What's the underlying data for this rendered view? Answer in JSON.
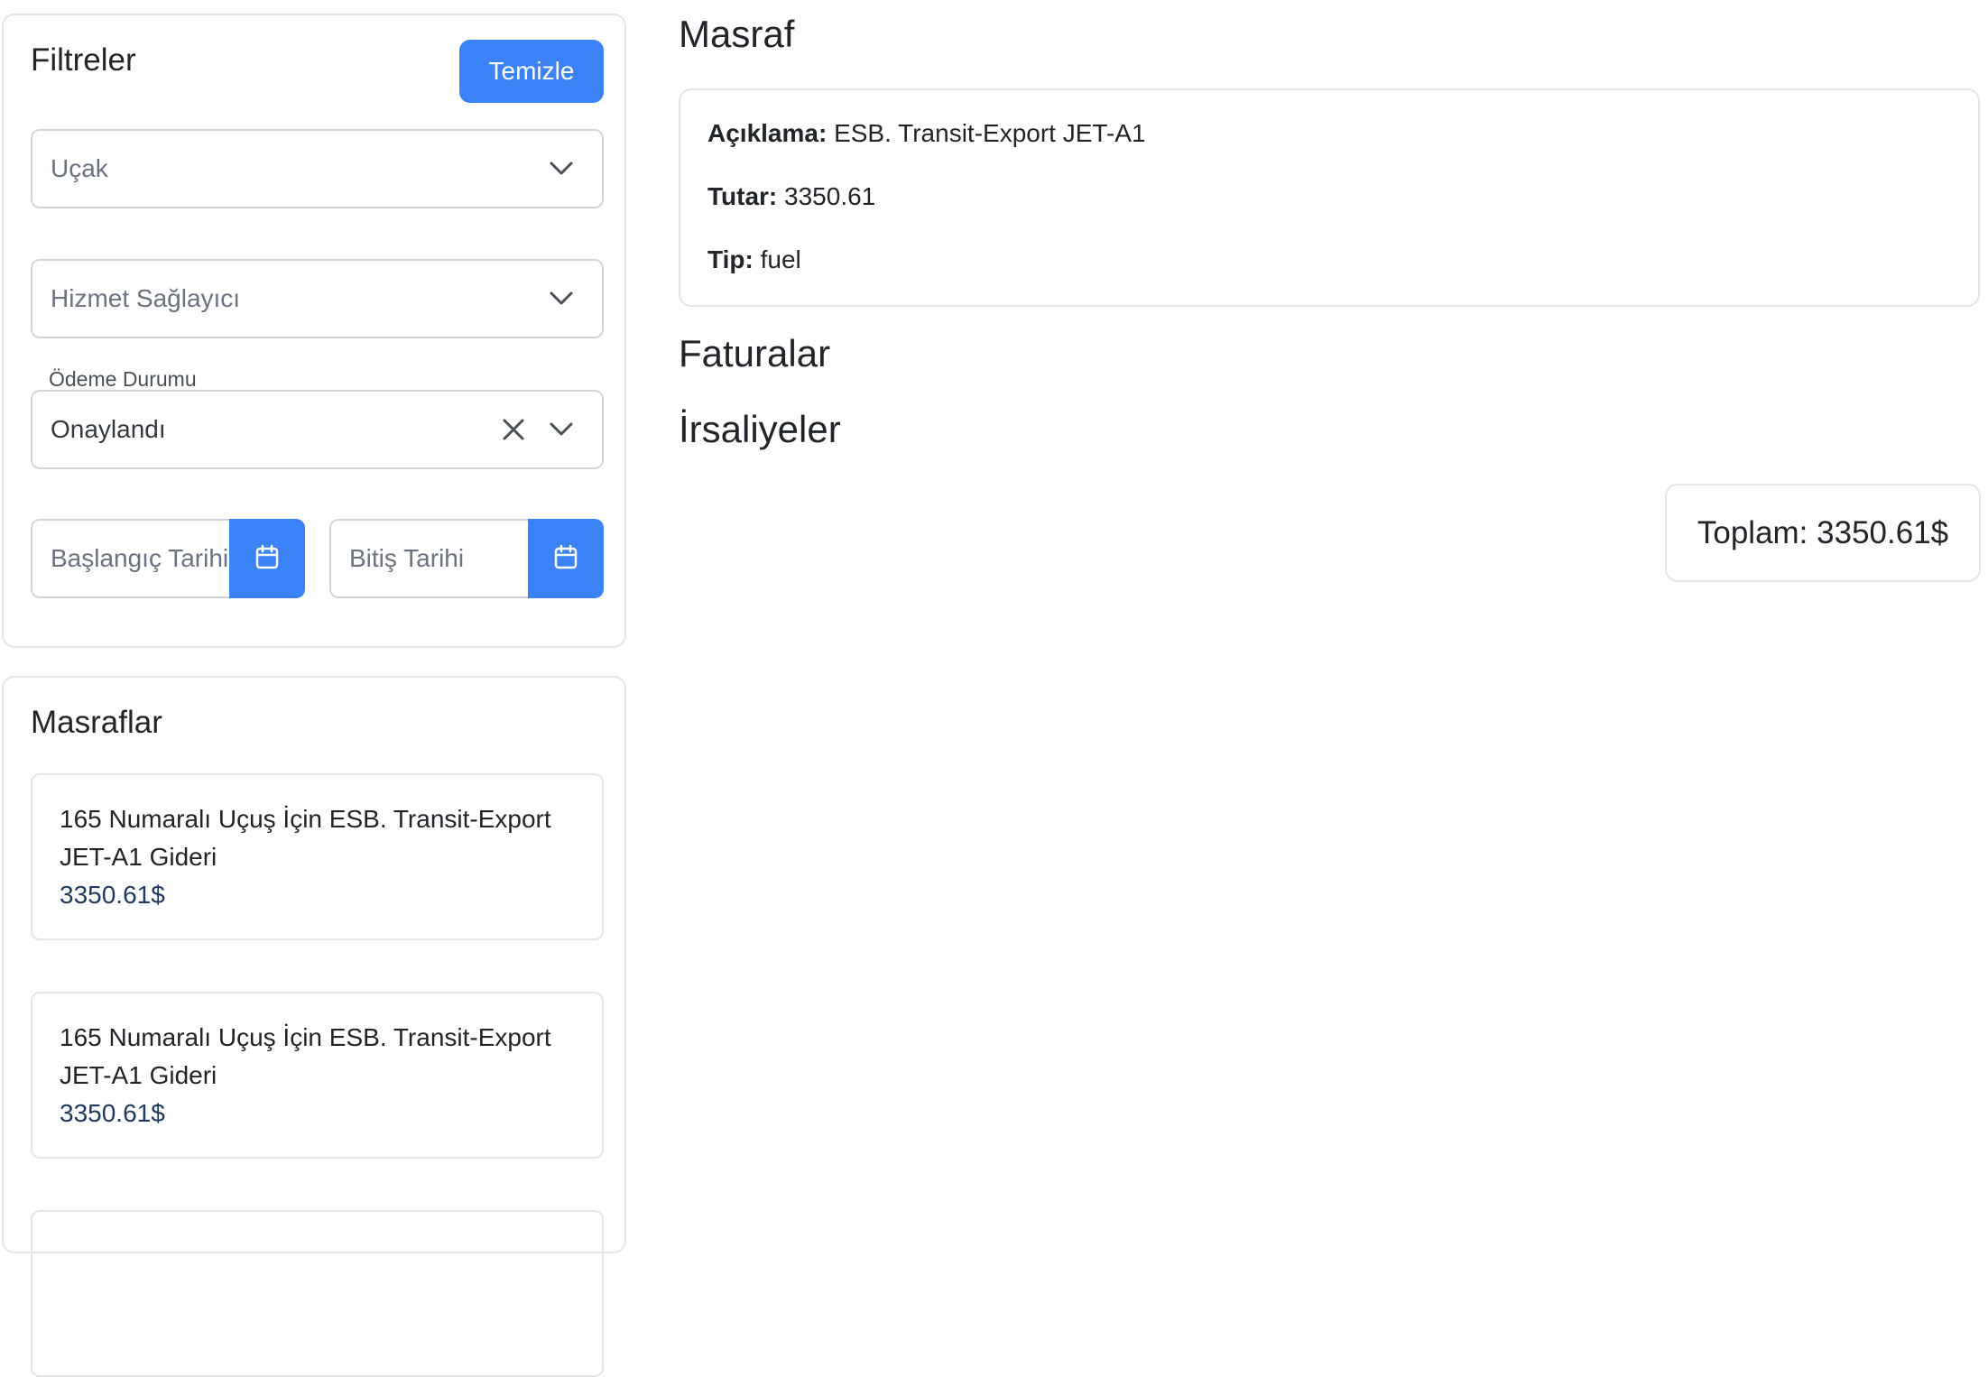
{
  "filters": {
    "title": "Filtreler",
    "clear_label": "Temizle",
    "aircraft_placeholder": "Uçak",
    "provider_placeholder": "Hizmet Sağlayıcı",
    "payment_label": "Ödeme Durumu",
    "payment_value": "Onaylandı",
    "start_date_placeholder": "Başlangıç Tarihi",
    "end_date_placeholder": "Bitiş Tarihi"
  },
  "expenses": {
    "title": "Masraflar",
    "items": [
      {
        "title": "165 Numaralı Uçuş İçin ESB. Transit-Export JET-A1 Gideri",
        "amount": "3350.61$"
      },
      {
        "title": "165 Numaralı Uçuş İçin ESB. Transit-Export JET-A1 Gideri",
        "amount": "3350.61$"
      },
      {
        "title": "",
        "amount": ""
      }
    ]
  },
  "detail": {
    "title": "Masraf",
    "desc_label": "Açıklama:",
    "desc_value": "ESB. Transit-Export JET-A1",
    "amount_label": "Tutar:",
    "amount_value": "3350.61",
    "type_label": "Tip:",
    "type_value": "fuel"
  },
  "invoices_title": "Faturalar",
  "waybills_title": "İrsaliyeler",
  "total_text": "Toplam: 3350.61$",
  "colors": {
    "accent": "#3b82f6",
    "border": "#e3e5e8",
    "amount": "#1e3a5f"
  }
}
